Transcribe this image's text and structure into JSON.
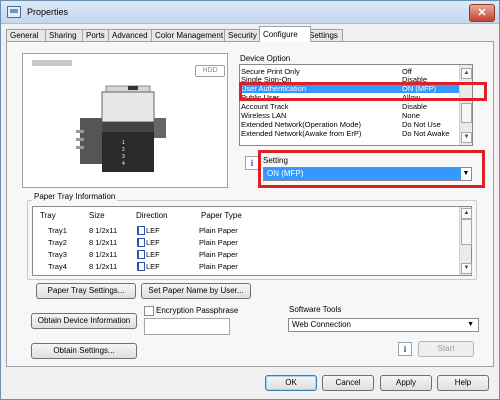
{
  "window": {
    "title": "Properties"
  },
  "tabs": [
    "General",
    "Sharing",
    "Ports",
    "Advanced",
    "Color Management",
    "Security",
    "Configure",
    "Settings"
  ],
  "active_tab": "Configure",
  "preview": {
    "hdd_badge": "HDD"
  },
  "device_option": {
    "label": "Device Option",
    "items": [
      {
        "name": "Secure Print Only",
        "value": "Off"
      },
      {
        "name": "Single Sign-On",
        "value": "Disable"
      },
      {
        "name": "User Authentication",
        "value": "ON (MFP)",
        "selected": true
      },
      {
        "name": "Public User",
        "value": "Allow"
      },
      {
        "name": "Account Track",
        "value": "Disable"
      },
      {
        "name": "Wireless LAN",
        "value": "None"
      },
      {
        "name": "Extended Network(Operation Mode)",
        "value": "Do Not Use"
      },
      {
        "name": "Extended Network(Awake from ErP)",
        "value": "Do Not Awake"
      }
    ]
  },
  "setting": {
    "label": "Setting",
    "value": "ON (MFP)"
  },
  "paper_tray": {
    "label": "Paper Tray Information",
    "columns": [
      "Tray",
      "Size",
      "Direction",
      "Paper Type"
    ],
    "rows": [
      {
        "tray": "Tray1",
        "size": "8 1/2x11",
        "direction": "LEF",
        "type": "Plain Paper"
      },
      {
        "tray": "Tray2",
        "size": "8 1/2x11",
        "direction": "LEF",
        "type": "Plain Paper"
      },
      {
        "tray": "Tray3",
        "size": "8 1/2x11",
        "direction": "LEF",
        "type": "Plain Paper"
      },
      {
        "tray": "Tray4",
        "size": "8 1/2x11",
        "direction": "LEF",
        "type": "Plain Paper"
      }
    ]
  },
  "buttons": {
    "paper_tray_settings": "Paper Tray Settings...",
    "set_paper_name": "Set Paper Name by User...",
    "obtain_device_info": "Obtain Device Information",
    "obtain_settings": "Obtain Settings...",
    "start": "Start",
    "ok": "OK",
    "cancel": "Cancel",
    "apply": "Apply",
    "help": "Help"
  },
  "encryption": {
    "label": "Encryption Passphrase",
    "checked": false,
    "value": ""
  },
  "software_tools": {
    "label": "Software Tools",
    "value": "Web Connection"
  },
  "colors": {
    "selection": "#3399ff",
    "highlight": "#dd1f26"
  }
}
